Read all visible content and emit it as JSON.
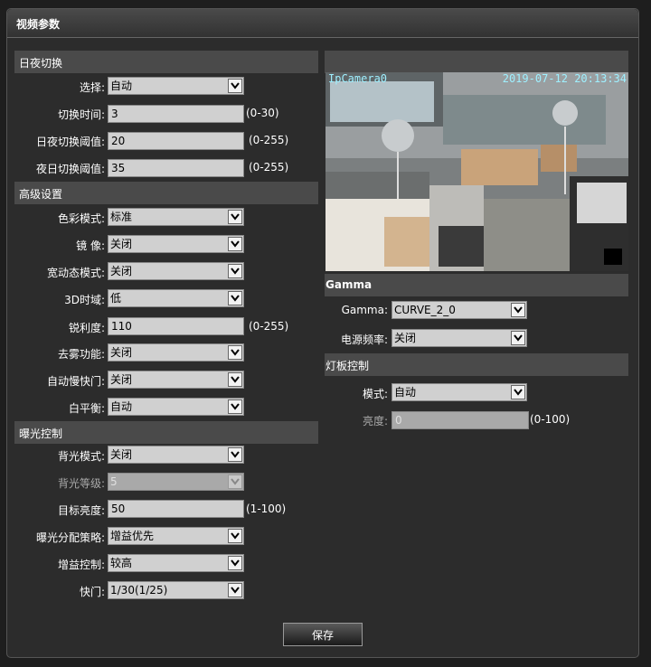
{
  "title": "视频参数",
  "day_night": {
    "header": "日夜切换",
    "mode_label": "选择:",
    "mode_value": "自动",
    "switch_time_label": "切换时间:",
    "switch_time_value": "3",
    "switch_time_range": "(0-30)",
    "day_night_threshold_label": "日夜切换阈值:",
    "day_night_threshold_value": "20",
    "day_night_threshold_range": "(0-255)",
    "night_day_threshold_label": "夜日切换阈值:",
    "night_day_threshold_value": "35",
    "night_day_threshold_range": "(0-255)"
  },
  "advanced": {
    "header": "高级设置",
    "color_mode_label": "色彩模式:",
    "color_mode_value": "标准",
    "mirror_label": "镜 像:",
    "mirror_value": "关闭",
    "wdr_label": "宽动态模式:",
    "wdr_value": "关闭",
    "dnr_label": "3D时域:",
    "dnr_value": "低",
    "sharpness_label": "锐利度:",
    "sharpness_value": "110",
    "sharpness_range": "(0-255)",
    "defog_label": "去雾功能:",
    "defog_value": "关闭",
    "slow_shutter_label": "自动慢快门:",
    "slow_shutter_value": "关闭",
    "white_balance_label": "白平衡:",
    "white_balance_value": "自动"
  },
  "exposure": {
    "header": "曝光控制",
    "backlight_mode_label": "背光模式:",
    "backlight_mode_value": "关闭",
    "backlight_level_label": "背光等级:",
    "backlight_level_value": "5",
    "target_brightness_label": "目标亮度:",
    "target_brightness_value": "50",
    "target_brightness_range": "(1-100)",
    "strategy_label": "曝光分配策略:",
    "strategy_value": "增益优先",
    "gain_label": "增益控制:",
    "gain_value": "较高",
    "shutter_label": "快门:",
    "shutter_value": "1/30(1/25)"
  },
  "preview": {
    "osd_name": "IpCamera0",
    "osd_time": "2019-07-12 20:13:34"
  },
  "gamma": {
    "header": "Gamma",
    "gamma_label": "Gamma:",
    "gamma_value": "CURVE_2_0",
    "power_freq_label": "电源频率:",
    "power_freq_value": "关闭"
  },
  "light_board": {
    "header": "灯板控制",
    "mode_label": "模式:",
    "mode_value": "自动",
    "brightness_label": "亮度:",
    "brightness_value": "0",
    "brightness_range": "(0-100)"
  },
  "save_label": "保存",
  "icons": {
    "dropdown": "chevron-down-icon"
  },
  "colors": {
    "background": "#1e1e1e",
    "panel": "#2c2c2c",
    "section_bar": "#4a4a4a",
    "field": "#d0d0d0",
    "osd_text": "#9ff0ff"
  }
}
